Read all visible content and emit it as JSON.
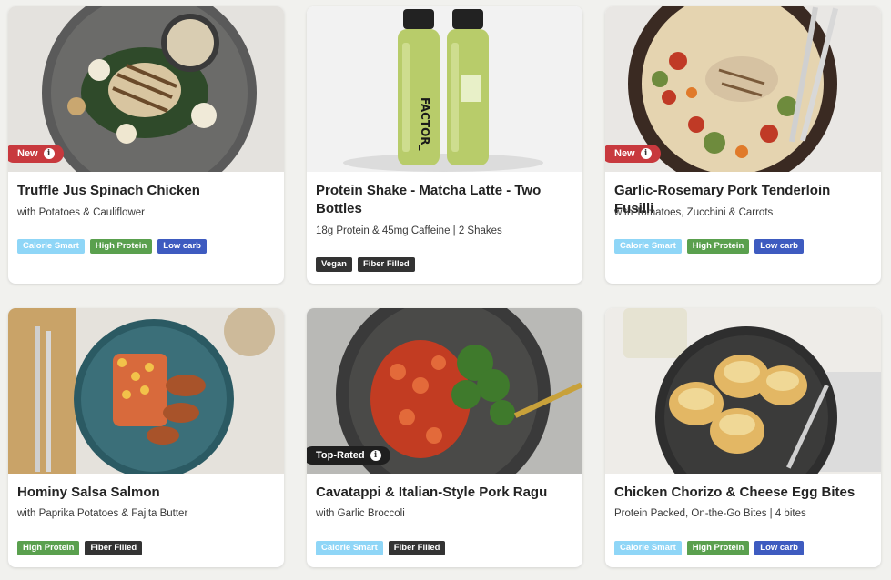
{
  "cards": [
    {
      "title": "Truffle Jus Spinach Chicken",
      "subtitle": "with Potatoes & Cauliflower",
      "badge": "New",
      "tags": [
        "Calorie Smart",
        "High Protein",
        "Low carb"
      ]
    },
    {
      "title": "Protein Shake - Matcha Latte - Two Bottles",
      "subtitle": "18g Protein & 45mg Caffeine | 2 Shakes",
      "bottle_text": "FACTOR_",
      "tags": [
        "Vegan",
        "Fiber Filled"
      ]
    },
    {
      "title": "Garlic-Rosemary Pork Tenderloin Fusilli",
      "subtitle": "with Tomatoes, Zucchini & Carrots",
      "badge": "New",
      "tags": [
        "Calorie Smart",
        "High Protein",
        "Low carb"
      ]
    },
    {
      "title": "Hominy Salsa Salmon",
      "subtitle": "with Paprika Potatoes & Fajita Butter",
      "tags": [
        "High Protein",
        "Fiber Filled"
      ]
    },
    {
      "title": "Cavatappi & Italian-Style Pork Ragu",
      "subtitle": "with Garlic Broccoli",
      "badge": "Top-Rated",
      "tags": [
        "Calorie Smart",
        "Fiber Filled"
      ]
    },
    {
      "title": "Chicken Chorizo & Cheese Egg Bites",
      "subtitle": "Protein Packed, On-the-Go Bites | 4 bites",
      "tags": [
        "Calorie Smart",
        "High Protein",
        "Low carb"
      ]
    }
  ],
  "badge_info_glyph": "i",
  "colors": {
    "new_badge": "#c8393e",
    "top_badge": "#1f1f1f",
    "calorie_smart": "#8fd6f7",
    "high_protein": "#5aa04e",
    "low_carb": "#3e5bc0",
    "dark_tag": "#333333"
  }
}
